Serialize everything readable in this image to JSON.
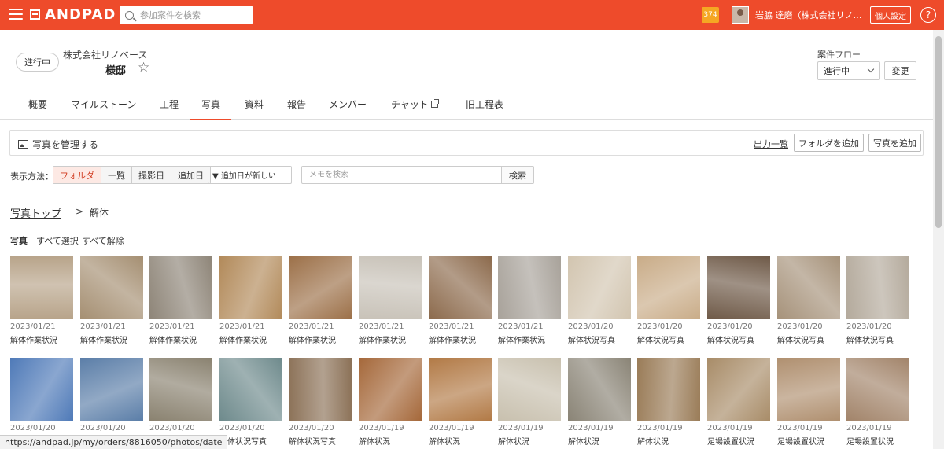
{
  "topbar": {
    "brand": "ANDPAD",
    "search_placeholder": "参加案件を検索",
    "notification_count": "374",
    "user_name": "岩脇 達磨（株式会社リノ…",
    "personal_settings": "個人設定",
    "help": "?"
  },
  "project": {
    "status": "進行中",
    "company": "株式会社リノベース",
    "name": "様邸",
    "flow_label": "案件フロー",
    "flow_value": "進行中",
    "change_button": "変更"
  },
  "tabs": [
    {
      "label": "概要"
    },
    {
      "label": "マイルストーン"
    },
    {
      "label": "工程"
    },
    {
      "label": "写真"
    },
    {
      "label": "資料"
    },
    {
      "label": "報告"
    },
    {
      "label": "メンバー"
    },
    {
      "label": "チャット"
    },
    {
      "label": "旧工程表"
    }
  ],
  "manage": {
    "title": "写真を管理する",
    "output_link": "出力一覧",
    "add_folder": "フォルダを追加",
    "add_photo": "写真を追加"
  },
  "view": {
    "label": "表示方法：",
    "options": [
      "フォルダ",
      "一覧",
      "撮影日",
      "追加日"
    ],
    "sort": "▼ 追加日が新しい",
    "memo_placeholder": "メモを検索",
    "search_button": "検索"
  },
  "breadcrumb": {
    "top": "写真トップ",
    "sep": ">",
    "current": "解体"
  },
  "selection": {
    "label": "写真",
    "select_all": "すべて選択",
    "deselect_all": "すべて解除"
  },
  "photos": [
    {
      "date": "2023/01/21",
      "caption": "解体作業状況",
      "tone": "#b8a48a"
    },
    {
      "date": "2023/01/21",
      "caption": "解体作業状況",
      "tone": "#a58f72"
    },
    {
      "date": "2023/01/21",
      "caption": "解体作業状況",
      "tone": "#8e8578"
    },
    {
      "date": "2023/01/21",
      "caption": "解体作業状況",
      "tone": "#b28a5a"
    },
    {
      "date": "2023/01/21",
      "caption": "解体作業状況",
      "tone": "#9c7048"
    },
    {
      "date": "2023/01/21",
      "caption": "解体作業状況",
      "tone": "#c8c2b8"
    },
    {
      "date": "2023/01/21",
      "caption": "解体作業状況",
      "tone": "#8c6a4c"
    },
    {
      "date": "2023/01/21",
      "caption": "解体作業状況",
      "tone": "#a8a29a"
    },
    {
      "date": "2023/01/20",
      "caption": "解体状況写真",
      "tone": "#d2c5b0"
    },
    {
      "date": "2023/01/20",
      "caption": "解体状況写真",
      "tone": "#c9ac88"
    },
    {
      "date": "2023/01/20",
      "caption": "解体状況写真",
      "tone": "#6f5a48"
    },
    {
      "date": "2023/01/20",
      "caption": "解体状況写真",
      "tone": "#a6927a"
    },
    {
      "date": "2023/01/20",
      "caption": "解体状況写真",
      "tone": "#b4aa9c"
    },
    {
      "date": "2023/01/20",
      "caption": "",
      "tone": "#4f7ab8"
    },
    {
      "date": "2023/01/20",
      "caption": "",
      "tone": "#5b7ea8"
    },
    {
      "date": "2023/01/20",
      "caption": "",
      "tone": "#8a8270"
    },
    {
      "date": "2023/01/20",
      "caption": "解体状況写真",
      "tone": "#6e8a8c"
    },
    {
      "date": "2023/01/20",
      "caption": "解体状況写真",
      "tone": "#8c7258"
    },
    {
      "date": "2023/01/19",
      "caption": "解体状況",
      "tone": "#a5683a"
    },
    {
      "date": "2023/01/19",
      "caption": "解体状況",
      "tone": "#b27a46"
    },
    {
      "date": "2023/01/19",
      "caption": "解体状況",
      "tone": "#c8c0ae"
    },
    {
      "date": "2023/01/19",
      "caption": "解体状況",
      "tone": "#8a8476"
    },
    {
      "date": "2023/01/19",
      "caption": "解体状況",
      "tone": "#9a7c58"
    },
    {
      "date": "2023/01/19",
      "caption": "足場設置状況",
      "tone": "#a88c68"
    },
    {
      "date": "2023/01/19",
      "caption": "足場設置状況",
      "tone": "#b09070"
    },
    {
      "date": "2023/01/19",
      "caption": "足場設置状況",
      "tone": "#a2846a"
    }
  ],
  "status_url": "https://andpad.jp/my/orders/8816050/photos/date",
  "colors": {
    "brand": "#ee4b2b",
    "badge": "#f5a623",
    "active_tab": "#ee4b2b"
  }
}
